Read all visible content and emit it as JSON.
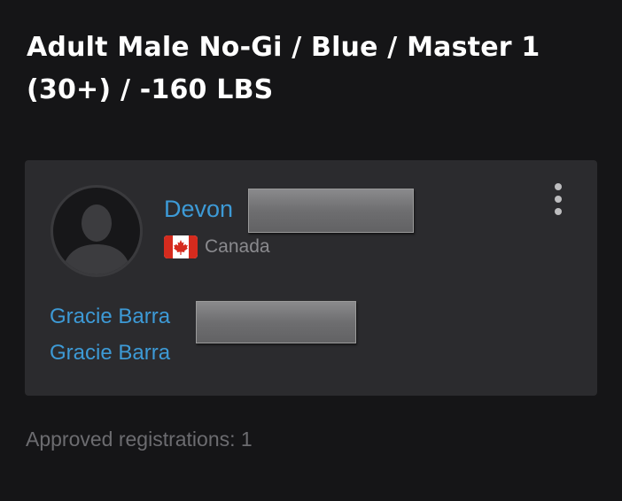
{
  "division": {
    "title": "Adult Male No-Gi / Blue / Master 1 (30+) / -160 LBS"
  },
  "athlete": {
    "avatar_icon": "user-silhouette-icon",
    "first_name": "Devon",
    "country": {
      "name": "Canada",
      "flag_icon": "canada-flag-icon"
    },
    "menu_icon": "more-vertical-icon",
    "teams": [
      {
        "label": "Gracie Barra"
      },
      {
        "label": "Gracie Barra"
      }
    ]
  },
  "footer": {
    "approved_text": "Approved registrations: 1"
  },
  "colors": {
    "background": "#151517",
    "card": "#2b2b2e",
    "link": "#3d9ad6",
    "muted_text": "#8a8a8e",
    "title_text": "#ffffff",
    "flag_red": "#d52b1e"
  }
}
